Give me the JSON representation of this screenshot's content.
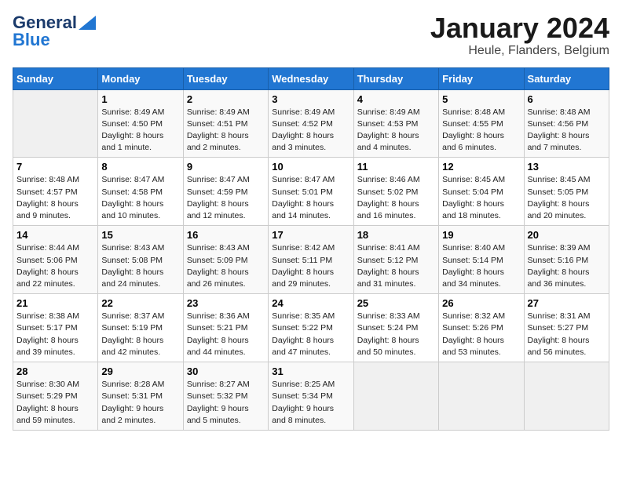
{
  "logo": {
    "line1": "General",
    "line2": "Blue"
  },
  "title": "January 2024",
  "subtitle": "Heule, Flanders, Belgium",
  "days_of_week": [
    "Sunday",
    "Monday",
    "Tuesday",
    "Wednesday",
    "Thursday",
    "Friday",
    "Saturday"
  ],
  "weeks": [
    [
      {
        "day": "",
        "info": ""
      },
      {
        "day": "1",
        "info": "Sunrise: 8:49 AM\nSunset: 4:50 PM\nDaylight: 8 hours\nand 1 minute."
      },
      {
        "day": "2",
        "info": "Sunrise: 8:49 AM\nSunset: 4:51 PM\nDaylight: 8 hours\nand 2 minutes."
      },
      {
        "day": "3",
        "info": "Sunrise: 8:49 AM\nSunset: 4:52 PM\nDaylight: 8 hours\nand 3 minutes."
      },
      {
        "day": "4",
        "info": "Sunrise: 8:49 AM\nSunset: 4:53 PM\nDaylight: 8 hours\nand 4 minutes."
      },
      {
        "day": "5",
        "info": "Sunrise: 8:48 AM\nSunset: 4:55 PM\nDaylight: 8 hours\nand 6 minutes."
      },
      {
        "day": "6",
        "info": "Sunrise: 8:48 AM\nSunset: 4:56 PM\nDaylight: 8 hours\nand 7 minutes."
      }
    ],
    [
      {
        "day": "7",
        "info": "Sunrise: 8:48 AM\nSunset: 4:57 PM\nDaylight: 8 hours\nand 9 minutes."
      },
      {
        "day": "8",
        "info": "Sunrise: 8:47 AM\nSunset: 4:58 PM\nDaylight: 8 hours\nand 10 minutes."
      },
      {
        "day": "9",
        "info": "Sunrise: 8:47 AM\nSunset: 4:59 PM\nDaylight: 8 hours\nand 12 minutes."
      },
      {
        "day": "10",
        "info": "Sunrise: 8:47 AM\nSunset: 5:01 PM\nDaylight: 8 hours\nand 14 minutes."
      },
      {
        "day": "11",
        "info": "Sunrise: 8:46 AM\nSunset: 5:02 PM\nDaylight: 8 hours\nand 16 minutes."
      },
      {
        "day": "12",
        "info": "Sunrise: 8:45 AM\nSunset: 5:04 PM\nDaylight: 8 hours\nand 18 minutes."
      },
      {
        "day": "13",
        "info": "Sunrise: 8:45 AM\nSunset: 5:05 PM\nDaylight: 8 hours\nand 20 minutes."
      }
    ],
    [
      {
        "day": "14",
        "info": "Sunrise: 8:44 AM\nSunset: 5:06 PM\nDaylight: 8 hours\nand 22 minutes."
      },
      {
        "day": "15",
        "info": "Sunrise: 8:43 AM\nSunset: 5:08 PM\nDaylight: 8 hours\nand 24 minutes."
      },
      {
        "day": "16",
        "info": "Sunrise: 8:43 AM\nSunset: 5:09 PM\nDaylight: 8 hours\nand 26 minutes."
      },
      {
        "day": "17",
        "info": "Sunrise: 8:42 AM\nSunset: 5:11 PM\nDaylight: 8 hours\nand 29 minutes."
      },
      {
        "day": "18",
        "info": "Sunrise: 8:41 AM\nSunset: 5:12 PM\nDaylight: 8 hours\nand 31 minutes."
      },
      {
        "day": "19",
        "info": "Sunrise: 8:40 AM\nSunset: 5:14 PM\nDaylight: 8 hours\nand 34 minutes."
      },
      {
        "day": "20",
        "info": "Sunrise: 8:39 AM\nSunset: 5:16 PM\nDaylight: 8 hours\nand 36 minutes."
      }
    ],
    [
      {
        "day": "21",
        "info": "Sunrise: 8:38 AM\nSunset: 5:17 PM\nDaylight: 8 hours\nand 39 minutes."
      },
      {
        "day": "22",
        "info": "Sunrise: 8:37 AM\nSunset: 5:19 PM\nDaylight: 8 hours\nand 42 minutes."
      },
      {
        "day": "23",
        "info": "Sunrise: 8:36 AM\nSunset: 5:21 PM\nDaylight: 8 hours\nand 44 minutes."
      },
      {
        "day": "24",
        "info": "Sunrise: 8:35 AM\nSunset: 5:22 PM\nDaylight: 8 hours\nand 47 minutes."
      },
      {
        "day": "25",
        "info": "Sunrise: 8:33 AM\nSunset: 5:24 PM\nDaylight: 8 hours\nand 50 minutes."
      },
      {
        "day": "26",
        "info": "Sunrise: 8:32 AM\nSunset: 5:26 PM\nDaylight: 8 hours\nand 53 minutes."
      },
      {
        "day": "27",
        "info": "Sunrise: 8:31 AM\nSunset: 5:27 PM\nDaylight: 8 hours\nand 56 minutes."
      }
    ],
    [
      {
        "day": "28",
        "info": "Sunrise: 8:30 AM\nSunset: 5:29 PM\nDaylight: 8 hours\nand 59 minutes."
      },
      {
        "day": "29",
        "info": "Sunrise: 8:28 AM\nSunset: 5:31 PM\nDaylight: 9 hours\nand 2 minutes."
      },
      {
        "day": "30",
        "info": "Sunrise: 8:27 AM\nSunset: 5:32 PM\nDaylight: 9 hours\nand 5 minutes."
      },
      {
        "day": "31",
        "info": "Sunrise: 8:25 AM\nSunset: 5:34 PM\nDaylight: 9 hours\nand 8 minutes."
      },
      {
        "day": "",
        "info": ""
      },
      {
        "day": "",
        "info": ""
      },
      {
        "day": "",
        "info": ""
      }
    ]
  ]
}
